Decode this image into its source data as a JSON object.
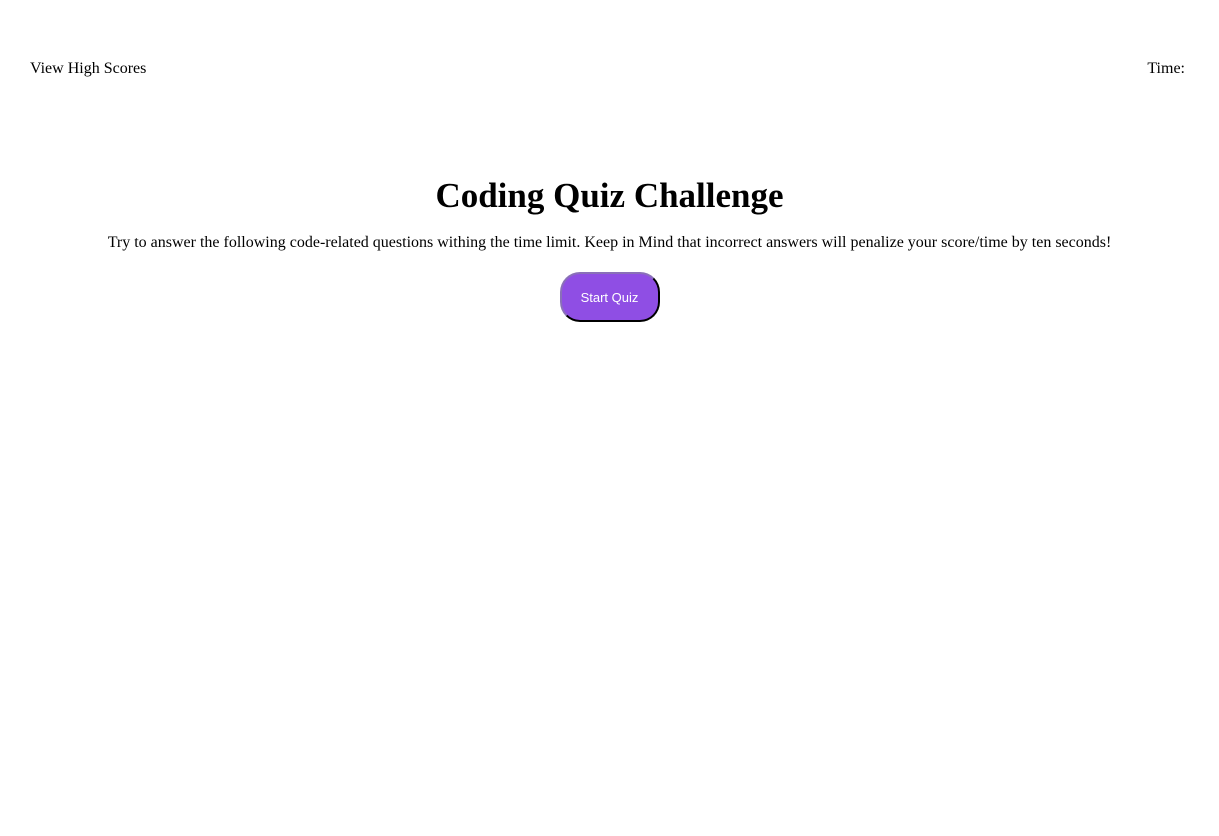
{
  "header": {
    "high_scores_link": "View High Scores",
    "time_label": "Time:",
    "time_value": ""
  },
  "intro": {
    "title": "Coding Quiz Challenge",
    "description": "Try to answer the following code-related questions withing the time limit. Keep in Mind that incorrect answers will penalize your score/time by ten seconds!",
    "start_button_label": "Start Quiz"
  },
  "colors": {
    "button_background": "#8f4ee4",
    "button_text": "#ffffff",
    "page_background": "#ffffff"
  }
}
